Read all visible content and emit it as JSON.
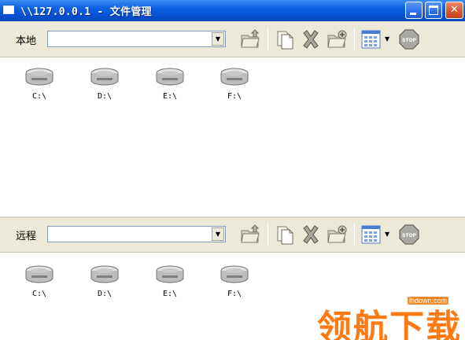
{
  "window": {
    "title": "\\\\127.0.0.1 - 文件管理",
    "buttons": {
      "min": "minimize-icon",
      "max": "maximize-icon",
      "close": "✕"
    }
  },
  "local": {
    "label": "本地",
    "path_value": "",
    "toolbar_icons": [
      "folder-up-icon",
      "copy-icon",
      "delete-icon",
      "new-folder-icon",
      "view-icon",
      "dropdown-icon",
      "stop-icon"
    ],
    "drives": [
      {
        "label": "C:\\"
      },
      {
        "label": "D:\\"
      },
      {
        "label": "E:\\"
      },
      {
        "label": "F:\\"
      }
    ]
  },
  "remote": {
    "label": "远程",
    "path_value": "",
    "toolbar_icons": [
      "folder-up-icon",
      "copy-icon",
      "delete-icon",
      "new-folder-icon",
      "view-icon",
      "dropdown-icon",
      "stop-icon"
    ],
    "drives": [
      {
        "label": "C:\\"
      },
      {
        "label": "D:\\"
      },
      {
        "label": "E:\\"
      },
      {
        "label": "F:\\"
      }
    ]
  },
  "stop_text": "STOP",
  "watermark": {
    "url": "lhdown.com",
    "text": "领航下载"
  },
  "colors": {
    "titlebar": "#0a5fe0",
    "toolbar": "#ece9d8",
    "watermark": "#ff7a12"
  }
}
